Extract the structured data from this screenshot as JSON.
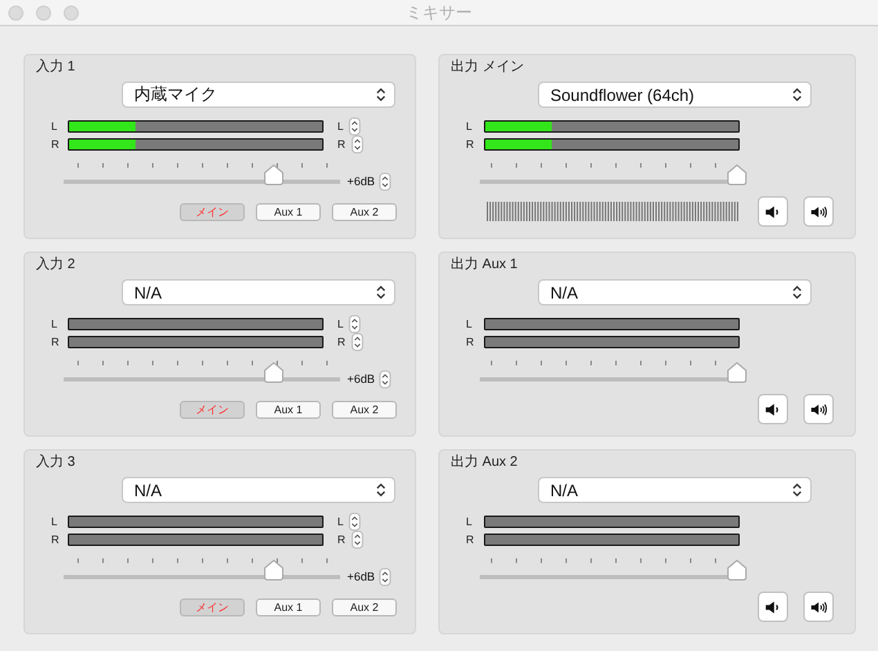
{
  "window": {
    "title": "ミキサー"
  },
  "inputs": [
    {
      "title": "入力 1",
      "device": "内蔵マイク",
      "meters": [
        {
          "label": "L",
          "side_label": "L",
          "level": 0.26
        },
        {
          "label": "R",
          "side_label": "R",
          "level": 0.26
        }
      ],
      "volume": {
        "level": 0.78
      },
      "gain": "+6dB",
      "routes": [
        {
          "label": "メイン",
          "selected": true
        },
        {
          "label": "Aux 1",
          "selected": false
        },
        {
          "label": "Aux 2",
          "selected": false
        }
      ]
    },
    {
      "title": "入力 2",
      "device": "N/A",
      "meters": [
        {
          "label": "L",
          "side_label": "L"
        },
        {
          "label": "R",
          "side_label": "R"
        }
      ],
      "volume": {
        "level": 0.78
      },
      "gain": "+6dB",
      "routes": [
        {
          "label": "メイン",
          "selected": true
        },
        {
          "label": "Aux 1",
          "selected": false
        },
        {
          "label": "Aux 2",
          "selected": false
        }
      ]
    },
    {
      "title": "入力 3",
      "device": "N/A",
      "meters": [
        {
          "label": "L",
          "side_label": "L"
        },
        {
          "label": "R",
          "side_label": "R"
        }
      ],
      "volume": {
        "level": 0.78
      },
      "gain": "+6dB",
      "routes": [
        {
          "label": "メイン",
          "selected": true
        },
        {
          "label": "Aux 1",
          "selected": false
        },
        {
          "label": "Aux 2",
          "selected": false
        }
      ]
    }
  ],
  "outputs": [
    {
      "title": "出力 メイン",
      "device": "Soundflower (64ch)",
      "meters": [
        {
          "label": "L",
          "level": 0.26
        },
        {
          "label": "R",
          "level": 0.26
        }
      ],
      "volume": {
        "level": 1
      },
      "waveform": true
    },
    {
      "title": "出力 Aux 1",
      "device": "N/A",
      "meters": [
        {
          "label": "L"
        },
        {
          "label": "R"
        }
      ],
      "volume": {
        "level": 1
      },
      "waveform": false
    },
    {
      "title": "出力 Aux 2",
      "device": "N/A",
      "meters": [
        {
          "label": "L"
        },
        {
          "label": "R"
        }
      ],
      "volume": {
        "level": 1
      },
      "waveform": false
    }
  ]
}
